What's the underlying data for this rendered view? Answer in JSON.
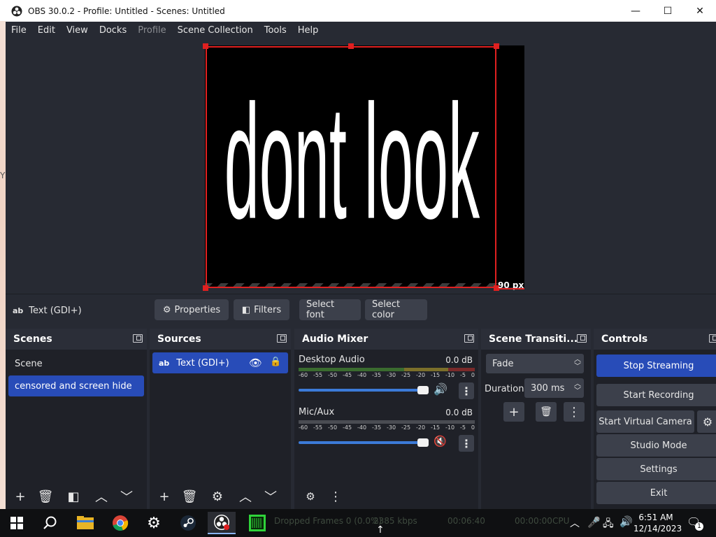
{
  "window": {
    "title": "OBS 30.0.2 - Profile: Untitled - Scenes: Untitled",
    "minimize_glyph": "—",
    "maximize_glyph": "☐",
    "close_glyph": "✕"
  },
  "desktop_letter": "Y",
  "menu": [
    "File",
    "Edit",
    "View",
    "Docks",
    "Profile",
    "Scene Collection",
    "Tools",
    "Help"
  ],
  "menu_disabled": [
    "Profile"
  ],
  "preview": {
    "text": "dont look",
    "crop_label": "90 px",
    "selection_color": "#e02020"
  },
  "source_toolbar": {
    "source_badge": "ab",
    "source_name": "Text (GDI+)",
    "properties": "Properties",
    "filters": "Filters",
    "select_font": "Select font",
    "select_color": "Select color"
  },
  "scenes": {
    "title": "Scenes",
    "items": [
      "Scene",
      "censored and screen hide"
    ],
    "selected": "censored and screen hide"
  },
  "sources": {
    "title": "Sources",
    "items": [
      {
        "badge": "ab",
        "name": "Text (GDI+)"
      }
    ]
  },
  "audio_mixer": {
    "title": "Audio Mixer",
    "ticks": [
      "-60",
      "-55",
      "-50",
      "-45",
      "-40",
      "-35",
      "-30",
      "-25",
      "-20",
      "-15",
      "-10",
      "-5",
      "0"
    ],
    "channels": [
      {
        "name": "Desktop Audio",
        "db": "0.0 dB",
        "volume": 1.0,
        "muted": false
      },
      {
        "name": "Mic/Aux",
        "db": "0.0 dB",
        "volume": 1.0,
        "muted": true
      }
    ]
  },
  "transitions": {
    "title": "Scene Transiti...",
    "selected": "Fade",
    "duration_label": "Duration",
    "duration_value": "300 ms"
  },
  "controls": {
    "title": "Controls",
    "stop_streaming": "Stop Streaming",
    "start_recording": "Start Recording",
    "start_virtual_camera": "Start Virtual Camera",
    "studio_mode": "Studio Mode",
    "settings": "Settings",
    "exit": "Exit"
  },
  "taskbar": {
    "ghost_text": [
      "Dropped Frames 0 (0.0%)",
      "2385 kbps",
      "00:06:40",
      "00:00:00",
      "CPU"
    ],
    "time": "6:51 AM",
    "date": "12/14/2023",
    "notification_count": "1"
  },
  "colors": {
    "app_bg": "#272a33",
    "dock_bg": "#1f2128",
    "accent": "#284cb8",
    "button": "#3c404b"
  }
}
